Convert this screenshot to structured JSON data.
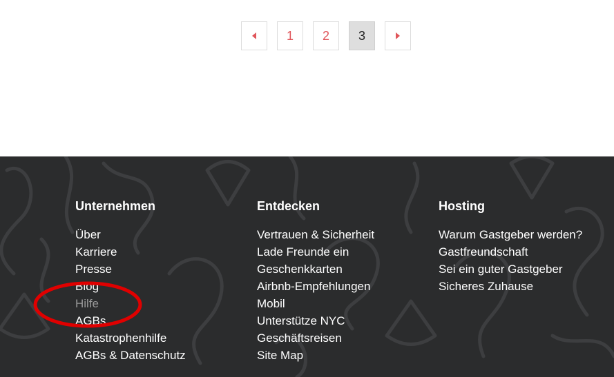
{
  "pagination": {
    "prev_icon": "caret-left-icon",
    "next_icon": "caret-right-icon",
    "pages": [
      "1",
      "2",
      "3"
    ],
    "current": "3"
  },
  "footer": {
    "columns": [
      {
        "title": "Unternehmen",
        "links": [
          "Über",
          "Karriere",
          "Presse",
          "Blog",
          "Hilfe",
          "AGBs",
          "Katastrophenhilfe",
          "AGBs & Datenschutz"
        ]
      },
      {
        "title": "Entdecken",
        "links": [
          "Vertrauen & Sicherheit",
          "Lade Freunde ein",
          "Geschenkkarten",
          "Airbnb-Empfehlungen",
          "Mobil",
          "Unterstütze NYC",
          "Geschäftsreisen",
          "Site Map"
        ]
      },
      {
        "title": "Hosting",
        "links": [
          "Warum Gastgeber werden?",
          "Gastfreundschaft",
          "Sei ein guter Gastgeber",
          "Sicheres Zuhause"
        ]
      }
    ]
  },
  "colors": {
    "accent": "#e0565b",
    "footer_bg": "#2b2c2d",
    "annotation": "#e00000"
  }
}
